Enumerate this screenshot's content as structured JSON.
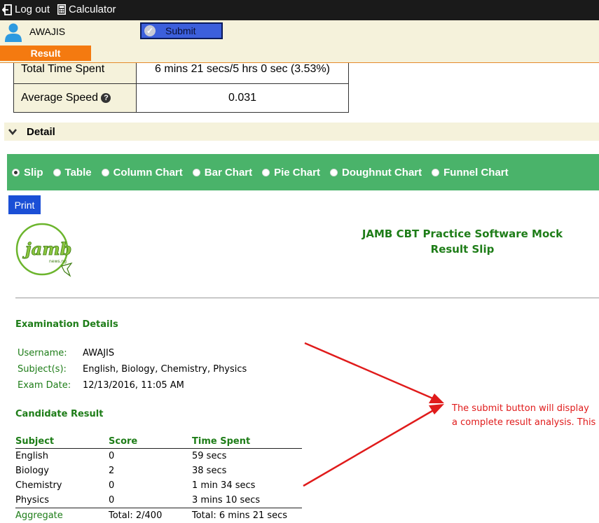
{
  "topbar": {
    "logout_label": "Log out",
    "calculator_label": "Calculator"
  },
  "user": {
    "name": "AWAJIS",
    "submit_label": "Submit"
  },
  "tabs": {
    "result_label": "Result"
  },
  "summary": {
    "rows": [
      {
        "label": "Total Time Spent",
        "value": "6 mins 21 secs/5 hrs 0 sec (3.53%)"
      },
      {
        "label": "Average Speed",
        "value": "0.031"
      }
    ]
  },
  "detail": {
    "label": "Detail"
  },
  "view_options": [
    "Slip",
    "Table",
    "Column Chart",
    "Bar Chart",
    "Pie Chart",
    "Doughnut Chart",
    "Funnel Chart"
  ],
  "selected_view": "Slip",
  "print_label": "Print",
  "slip": {
    "logo_text": "jamb",
    "logo_subtext": "news.ng",
    "title_line1": "JAMB CBT Practice Software Mock",
    "title_line2": "Result Slip",
    "exam_details_title": "Examination Details",
    "exam_details": [
      {
        "label": "Username:",
        "value": "AWAJIS"
      },
      {
        "label": "Subject(s):",
        "value": "English, Biology, Chemistry, Physics"
      },
      {
        "label": "Exam Date:",
        "value": "12/13/2016, 11:05 AM"
      }
    ],
    "candidate_result_title": "Candidate Result",
    "columns": [
      "Subject",
      "Score",
      "Time Spent"
    ],
    "rows": [
      {
        "subject": "English",
        "score": "0",
        "time": "59 secs"
      },
      {
        "subject": "Biology",
        "score": "2",
        "time": "38 secs"
      },
      {
        "subject": "Chemistry",
        "score": "0",
        "time": "1 min 34 secs"
      },
      {
        "subject": "Physics",
        "score": "0",
        "time": "3 mins 10 secs"
      }
    ],
    "aggregate": {
      "label": "Aggregate",
      "score": "Total: 2/400",
      "time": "Total: 6 mins 21 secs"
    }
  },
  "annotation": {
    "line1": "The submit button will display",
    "line2": "a complete result analysis. This"
  },
  "colors": {
    "accent_green": "#4ab36a",
    "text_green": "#1e7d18",
    "tab_orange": "#f47a10",
    "submit_blue": "#3c5fdc",
    "annotation_red": "#e01b1b"
  }
}
